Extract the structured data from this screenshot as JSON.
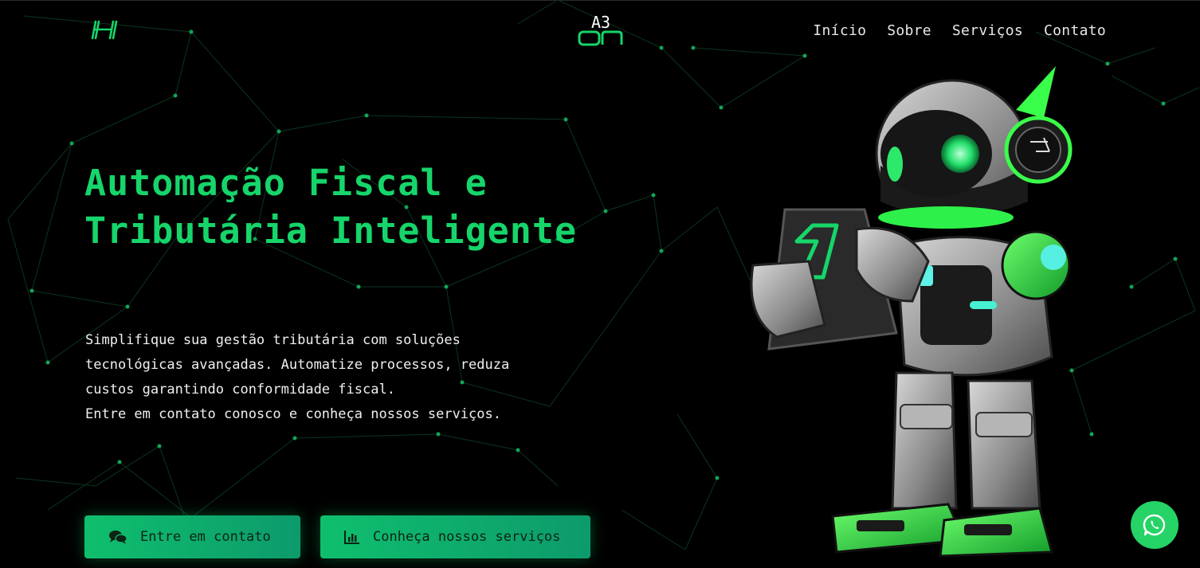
{
  "brand": {
    "logo_top": "A3",
    "logo_bottom": "ON"
  },
  "nav": {
    "items": [
      "Início",
      "Sobre",
      "Serviços",
      "Contato"
    ]
  },
  "hero": {
    "title_line1": "Automação Fiscal e",
    "title_line2": "Tributária Inteligente",
    "desc_line1": "Simplifique sua gestão tributária com soluções",
    "desc_line2": "tecnológicas avançadas. Automatize processos, reduza",
    "desc_line3": "custos garantindo conformidade fiscal.",
    "desc_line4": "Entre em contato conosco e conheça nossos serviços."
  },
  "buttons": {
    "contact": "Entre em contato",
    "services": "Conheça nossos serviços"
  },
  "icons": {
    "logo": "h-logo-icon",
    "contact": "chat-bubbles-icon",
    "services": "bar-chart-icon",
    "whatsapp": "whatsapp-icon"
  },
  "colors": {
    "accent": "#16d56a",
    "button_start": "#0fbf6d",
    "button_end": "#0d9a6c",
    "whatsapp": "#25d366",
    "background": "#000000"
  }
}
